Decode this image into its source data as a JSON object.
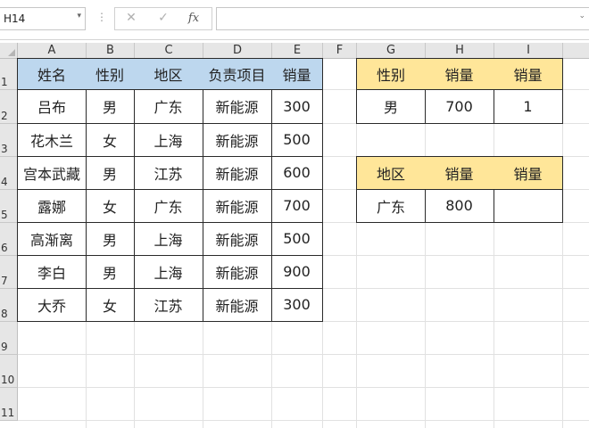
{
  "formula_bar": {
    "name_box": "H14",
    "dropdown_icon": "▾",
    "separator": "⋮",
    "cancel_icon": "✕",
    "confirm_icon": "✓",
    "fx_label": "fx",
    "formula": "",
    "expand_icon": "⌄"
  },
  "columns": [
    "A",
    "B",
    "C",
    "D",
    "E",
    "F",
    "G",
    "H",
    "I"
  ],
  "rows": [
    "1",
    "2",
    "3",
    "4",
    "5",
    "6",
    "7",
    "8",
    "9",
    "10",
    "11"
  ],
  "main_table": {
    "headers": [
      "姓名",
      "性别",
      "地区",
      "负责项目",
      "销量"
    ],
    "rows": [
      [
        "吕布",
        "男",
        "广东",
        "新能源",
        "300"
      ],
      [
        "花木兰",
        "女",
        "上海",
        "新能源",
        "500"
      ],
      [
        "宫本武藏",
        "男",
        "江苏",
        "新能源",
        "600"
      ],
      [
        "露娜",
        "女",
        "广东",
        "新能源",
        "700"
      ],
      [
        "高渐离",
        "男",
        "上海",
        "新能源",
        "500"
      ],
      [
        "李白",
        "男",
        "上海",
        "新能源",
        "900"
      ],
      [
        "大乔",
        "女",
        "江苏",
        "新能源",
        "300"
      ]
    ]
  },
  "criteria_table_1": {
    "headers": [
      "性别",
      "销量",
      "销量"
    ],
    "values": [
      "男",
      "700",
      "1"
    ]
  },
  "criteria_table_2": {
    "headers": [
      "地区",
      "销量",
      "销量"
    ],
    "values": [
      "广东",
      "800",
      ""
    ]
  },
  "colors": {
    "header_blue": "#bdd7ee",
    "header_orange": "#ffe699",
    "gridline": "#e1e1e1",
    "headings_bg": "#e6e6e6"
  }
}
